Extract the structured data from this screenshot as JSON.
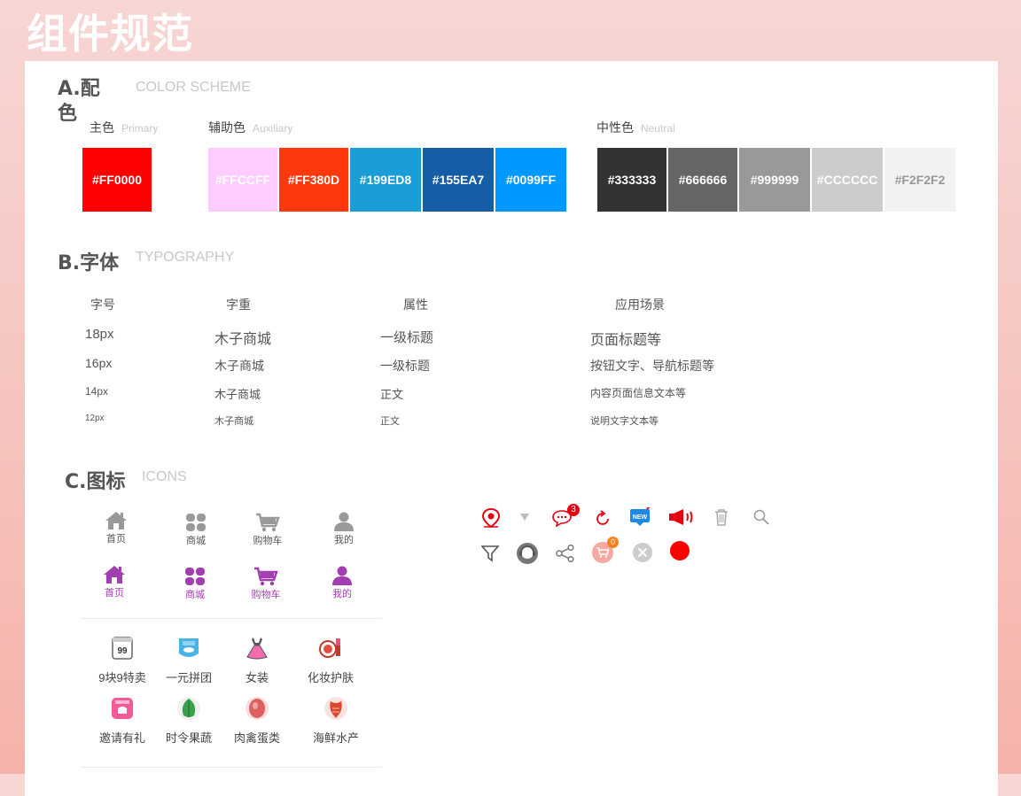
{
  "page_title": "组件规范",
  "sections": {
    "color": {
      "title": "A.配色",
      "subtitle": "COLOR SCHEME"
    },
    "typography": {
      "title": "B.字体",
      "subtitle": "TYPOGRAPHY"
    },
    "icons": {
      "title": "C.图标",
      "subtitle": "ICONS"
    }
  },
  "color_groups": {
    "primary": {
      "label": "主色",
      "sub": "Primary"
    },
    "auxiliary": {
      "label": "辅助色",
      "sub": "Auxiliary"
    },
    "neutral": {
      "label": "中性色",
      "sub": "Neutral"
    }
  },
  "swatches": {
    "primary": [
      {
        "hex": "#FF0000",
        "text_color": "#ffffff"
      }
    ],
    "auxiliary": [
      {
        "hex": "#FFCCFF",
        "text_color": "#ffffff"
      },
      {
        "hex": "#FF380D",
        "text_color": "#ffffff"
      },
      {
        "hex": "#199ED8",
        "text_color": "#ffffff"
      },
      {
        "hex": "#155EA7",
        "text_color": "#ffffff"
      },
      {
        "hex": "#0099FF",
        "text_color": "#ffffff"
      }
    ],
    "neutral": [
      {
        "hex": "#333333",
        "text_color": "#ffffff"
      },
      {
        "hex": "#666666",
        "text_color": "#ffffff"
      },
      {
        "hex": "#999999",
        "text_color": "#ffffff"
      },
      {
        "hex": "#CCCCCC",
        "text_color": "#ffffff"
      },
      {
        "hex": "#F2F2F2",
        "text_color": "#999999"
      }
    ]
  },
  "typography": {
    "headers": [
      "字号",
      "字重",
      "属性",
      "应用场景"
    ],
    "rows": [
      {
        "size": "18px",
        "weight": "木子商城",
        "attr": "一级标题",
        "usage": "页面标题等"
      },
      {
        "size": "16px",
        "weight": "木子商城",
        "attr": "一级标题",
        "usage": "按钮文字、导航标题等"
      },
      {
        "size": "14px",
        "weight": "木子商城",
        "attr": "正文",
        "usage": "内容页面信息文本等"
      },
      {
        "size": "12px",
        "weight": "木子商城",
        "attr": "正文",
        "usage": "说明文字文本等"
      }
    ]
  },
  "tab_icons": {
    "inactive": [
      {
        "icon": "home-icon",
        "label": "首页"
      },
      {
        "icon": "grid-icon",
        "label": "商城"
      },
      {
        "icon": "cart-icon",
        "label": "购物车"
      },
      {
        "icon": "user-icon",
        "label": "我的"
      }
    ],
    "active": [
      {
        "icon": "home-icon",
        "label": "首页"
      },
      {
        "icon": "grid-icon",
        "label": "商城"
      },
      {
        "icon": "cart-icon",
        "label": "购物车"
      },
      {
        "icon": "user-icon",
        "label": "我的"
      }
    ],
    "inactive_color": "#999999",
    "active_color": "#a33eb2"
  },
  "categories": [
    {
      "icon": "discount-99-icon",
      "label": "9块9特卖"
    },
    {
      "icon": "group-buy-icon",
      "label": "一元拼团"
    },
    {
      "icon": "dress-icon",
      "label": "女装"
    },
    {
      "icon": "cosmetics-icon",
      "label": "化妆护肤"
    },
    {
      "icon": "invite-icon",
      "label": "邀请有礼"
    },
    {
      "icon": "vegetable-icon",
      "label": "时令果蔬"
    },
    {
      "icon": "meat-icon",
      "label": "肉禽蛋类"
    },
    {
      "icon": "seafood-icon",
      "label": "海鲜水产"
    }
  ],
  "misc_icons": {
    "message_badge": "3",
    "cart_badge": "0",
    "row1": [
      "location-icon",
      "dropdown-arrow-icon",
      "message-icon",
      "refresh-icon",
      "new-badge-icon",
      "megaphone-icon",
      "trash-icon",
      "search-icon"
    ],
    "row2": [
      "filter-icon",
      "customer-service-icon",
      "share-icon",
      "cart-round-icon",
      "close-circle-icon",
      "red-dot-icon"
    ]
  }
}
